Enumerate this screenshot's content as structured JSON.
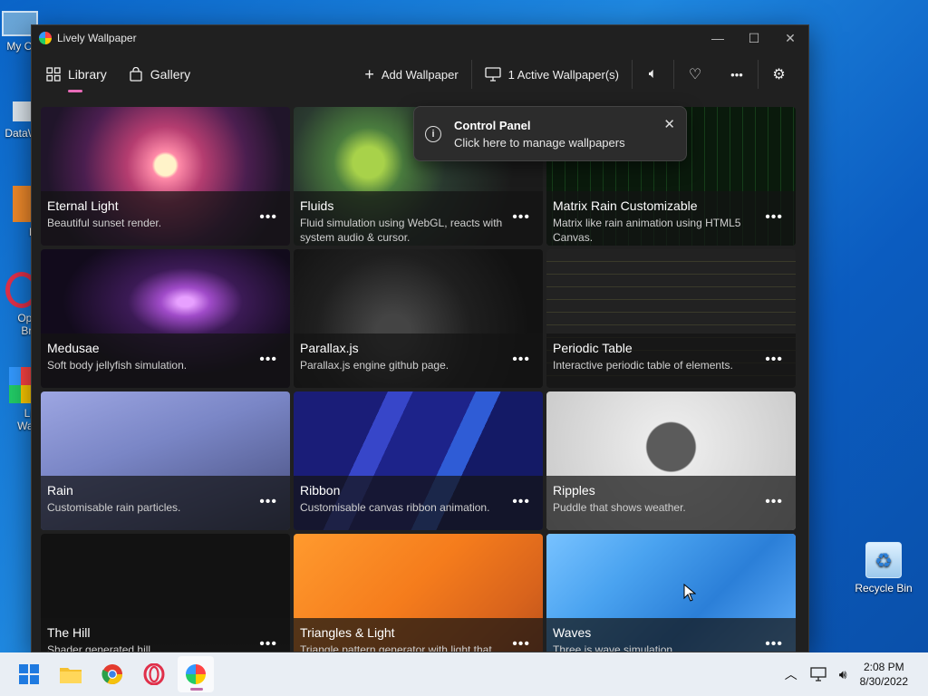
{
  "desktop": {
    "left_labels": [
      "My Co",
      "DataW",
      "Fi",
      "Ope",
      "Bro",
      "Liv",
      "Wall"
    ],
    "recycle_bin": "Recycle Bin"
  },
  "window": {
    "title": "Lively Wallpaper",
    "controls": {
      "minimize": "—",
      "maximize": "☐",
      "close": "✕"
    }
  },
  "nav": {
    "library": "Library",
    "gallery": "Gallery",
    "add_wallpaper": "Add Wallpaper",
    "active_wallpapers": "1 Active Wallpaper(s)"
  },
  "toast": {
    "title": "Control Panel",
    "body": "Click here to manage wallpapers"
  },
  "wallpapers": [
    {
      "name": "Eternal Light",
      "desc": "Beautiful sunset render."
    },
    {
      "name": "Fluids",
      "desc": "Fluid simulation using WebGL, reacts with system audio & cursor."
    },
    {
      "name": "Matrix Rain Customizable",
      "desc": "Matrix like rain animation using HTML5 Canvas."
    },
    {
      "name": "Medusae",
      "desc": "Soft body jellyfish simulation."
    },
    {
      "name": "Parallax.js",
      "desc": "Parallax.js engine github page."
    },
    {
      "name": "Periodic Table",
      "desc": "Interactive periodic table of elements."
    },
    {
      "name": "Rain",
      "desc": "Customisable rain particles."
    },
    {
      "name": "Ribbon",
      "desc": "Customisable canvas ribbon animation."
    },
    {
      "name": "Ripples",
      "desc": "Puddle that shows weather."
    },
    {
      "name": "The Hill",
      "desc": "Shader generated hill."
    },
    {
      "name": "Triangles & Light",
      "desc": "Triangle pattern generator with light that"
    },
    {
      "name": "Waves",
      "desc": "Three.js wave simulation."
    }
  ],
  "more_label": "•••",
  "taskbar": {
    "time": "2:08 PM",
    "date": "8/30/2022"
  }
}
